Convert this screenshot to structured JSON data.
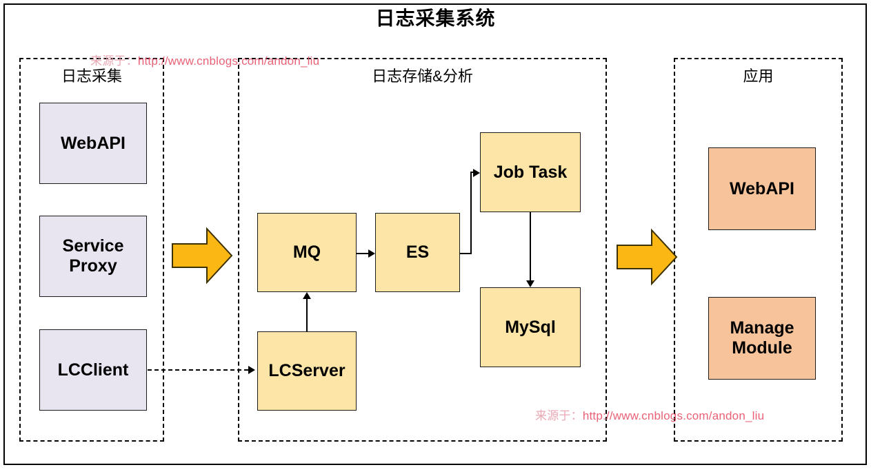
{
  "title": "日志采集系统",
  "watermarks": [
    {
      "id": "top",
      "prefix": "来源于：",
      "url": "http://www.cnblogs.com/andon_liu"
    },
    {
      "id": "bottom",
      "prefix": "来源于：",
      "url": "http://www.cnblogs.com/andon_liu"
    }
  ],
  "panels": [
    {
      "id": "collect",
      "label": "日志采集"
    },
    {
      "id": "store",
      "label": "日志存储&分析"
    },
    {
      "id": "app",
      "label": "应用"
    }
  ],
  "nodes": {
    "collect": [
      {
        "id": "webapi-collect",
        "label": "WebAPI"
      },
      {
        "id": "service-proxy",
        "label": "Service\nProxy"
      },
      {
        "id": "lcclient",
        "label": "LCClient"
      }
    ],
    "store": [
      {
        "id": "mq",
        "label": "MQ"
      },
      {
        "id": "es",
        "label": "ES"
      },
      {
        "id": "job-task",
        "label": "Job Task"
      },
      {
        "id": "mysql",
        "label": "MySql"
      },
      {
        "id": "lcserver",
        "label": "LCServer"
      }
    ],
    "app": [
      {
        "id": "webapi-app",
        "label": "WebAPI"
      },
      {
        "id": "manage-module",
        "label": "Manage\nModule"
      }
    ]
  },
  "colors": {
    "collect_fill": "#e8e4f0",
    "store_fill": "#fce5a6",
    "app_fill": "#f7c39a",
    "block_arrow_fill": "#fbb713",
    "watermark": "#e8546b",
    "stroke": "#000000"
  },
  "connections": [
    {
      "id": "lcclient-to-lcserver",
      "from": "lcclient",
      "to": "lcserver",
      "style": "dashed"
    },
    {
      "id": "lcserver-to-mq",
      "from": "lcserver",
      "to": "mq",
      "style": "solid"
    },
    {
      "id": "mq-to-es",
      "from": "mq",
      "to": "es",
      "style": "solid"
    },
    {
      "id": "es-to-job-task",
      "from": "es",
      "to": "job-task",
      "style": "solid"
    },
    {
      "id": "job-task-to-mysql",
      "from": "job-task",
      "to": "mysql",
      "style": "solid"
    },
    {
      "id": "collect-to-store",
      "from": "collect",
      "to": "store",
      "style": "block-arrow"
    },
    {
      "id": "store-to-app",
      "from": "store",
      "to": "app",
      "style": "block-arrow"
    }
  ]
}
